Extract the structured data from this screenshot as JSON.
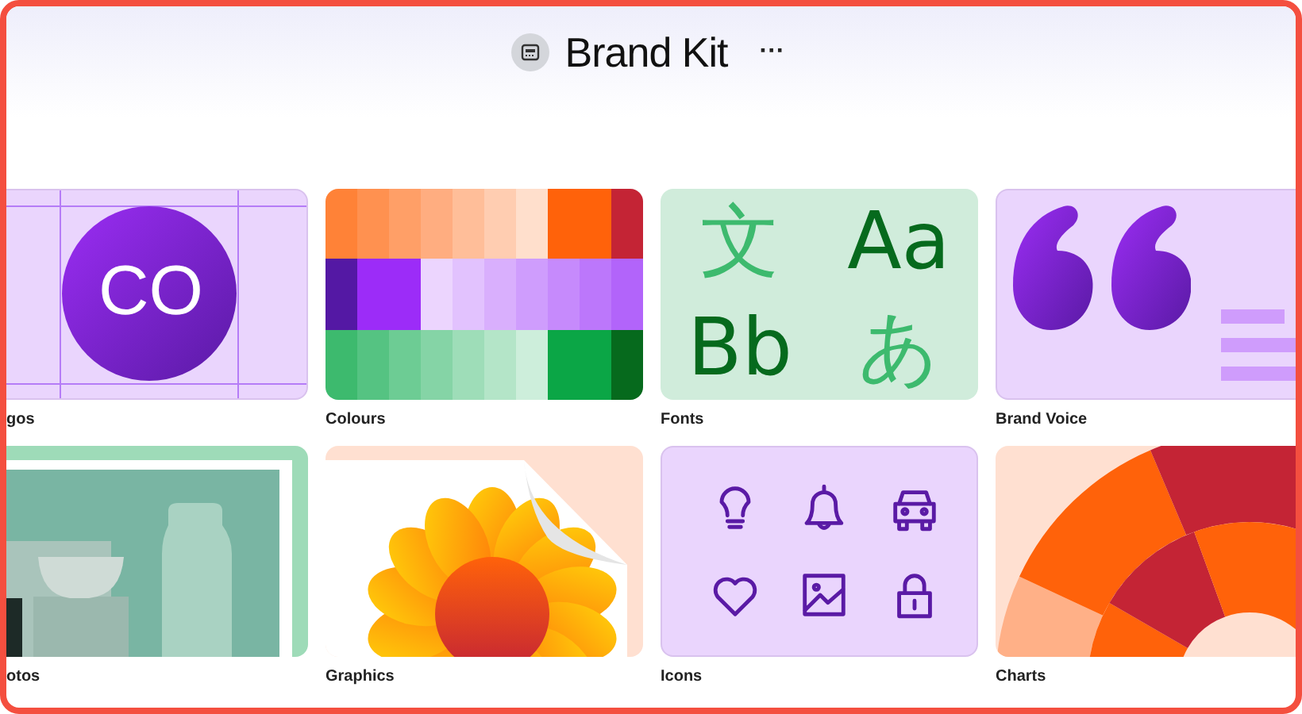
{
  "header": {
    "title": "Brand Kit",
    "menu": "···"
  },
  "cards": [
    {
      "kind": "logos",
      "label": "gos",
      "logo_text": "CO"
    },
    {
      "kind": "colours",
      "label": "Colours",
      "palette": [
        [
          {
            "color": "#ff8237",
            "wide": false
          },
          {
            "color": "#ff9150",
            "wide": false
          },
          {
            "color": "#ff9f67",
            "wide": false
          },
          {
            "color": "#ffad80",
            "wide": false
          },
          {
            "color": "#ffbe99",
            "wide": false
          },
          {
            "color": "#ffcdb1",
            "wide": false
          },
          {
            "color": "#ffdfcc",
            "wide": false
          },
          {
            "color": "#ff620a",
            "wide": true
          },
          {
            "color": "#c42435",
            "wide": false
          }
        ],
        [
          {
            "color": "#5418a4",
            "wide": false
          },
          {
            "color": "#9c2cf8",
            "wide": true
          },
          {
            "color": "#ecd5fe",
            "wide": false
          },
          {
            "color": "#e2c2fe",
            "wide": false
          },
          {
            "color": "#d9affd",
            "wide": false
          },
          {
            "color": "#cf9dfd",
            "wide": false
          },
          {
            "color": "#c68afc",
            "wide": false
          },
          {
            "color": "#bc77fb",
            "wide": false
          },
          {
            "color": "#b264fa",
            "wide": false
          }
        ],
        [
          {
            "color": "#3dba6e",
            "wide": false
          },
          {
            "color": "#55c382",
            "wide": false
          },
          {
            "color": "#6dcc94",
            "wide": false
          },
          {
            "color": "#85d4a6",
            "wide": false
          },
          {
            "color": "#9eddb8",
            "wide": false
          },
          {
            "color": "#b4e5c8",
            "wide": false
          },
          {
            "color": "#cdeedb",
            "wide": false
          },
          {
            "color": "#0ba646",
            "wide": true
          },
          {
            "color": "#066a1d",
            "wide": false
          }
        ]
      ]
    },
    {
      "kind": "fonts",
      "label": "Fonts",
      "samples": [
        "文",
        "Aa",
        "Bb",
        "あ"
      ]
    },
    {
      "kind": "voice",
      "label": "Brand Voice"
    },
    {
      "kind": "photos",
      "label": "otos"
    },
    {
      "kind": "graphics",
      "label": "Graphics"
    },
    {
      "kind": "icons",
      "label": "Icons"
    },
    {
      "kind": "charts",
      "label": "Charts"
    }
  ]
}
